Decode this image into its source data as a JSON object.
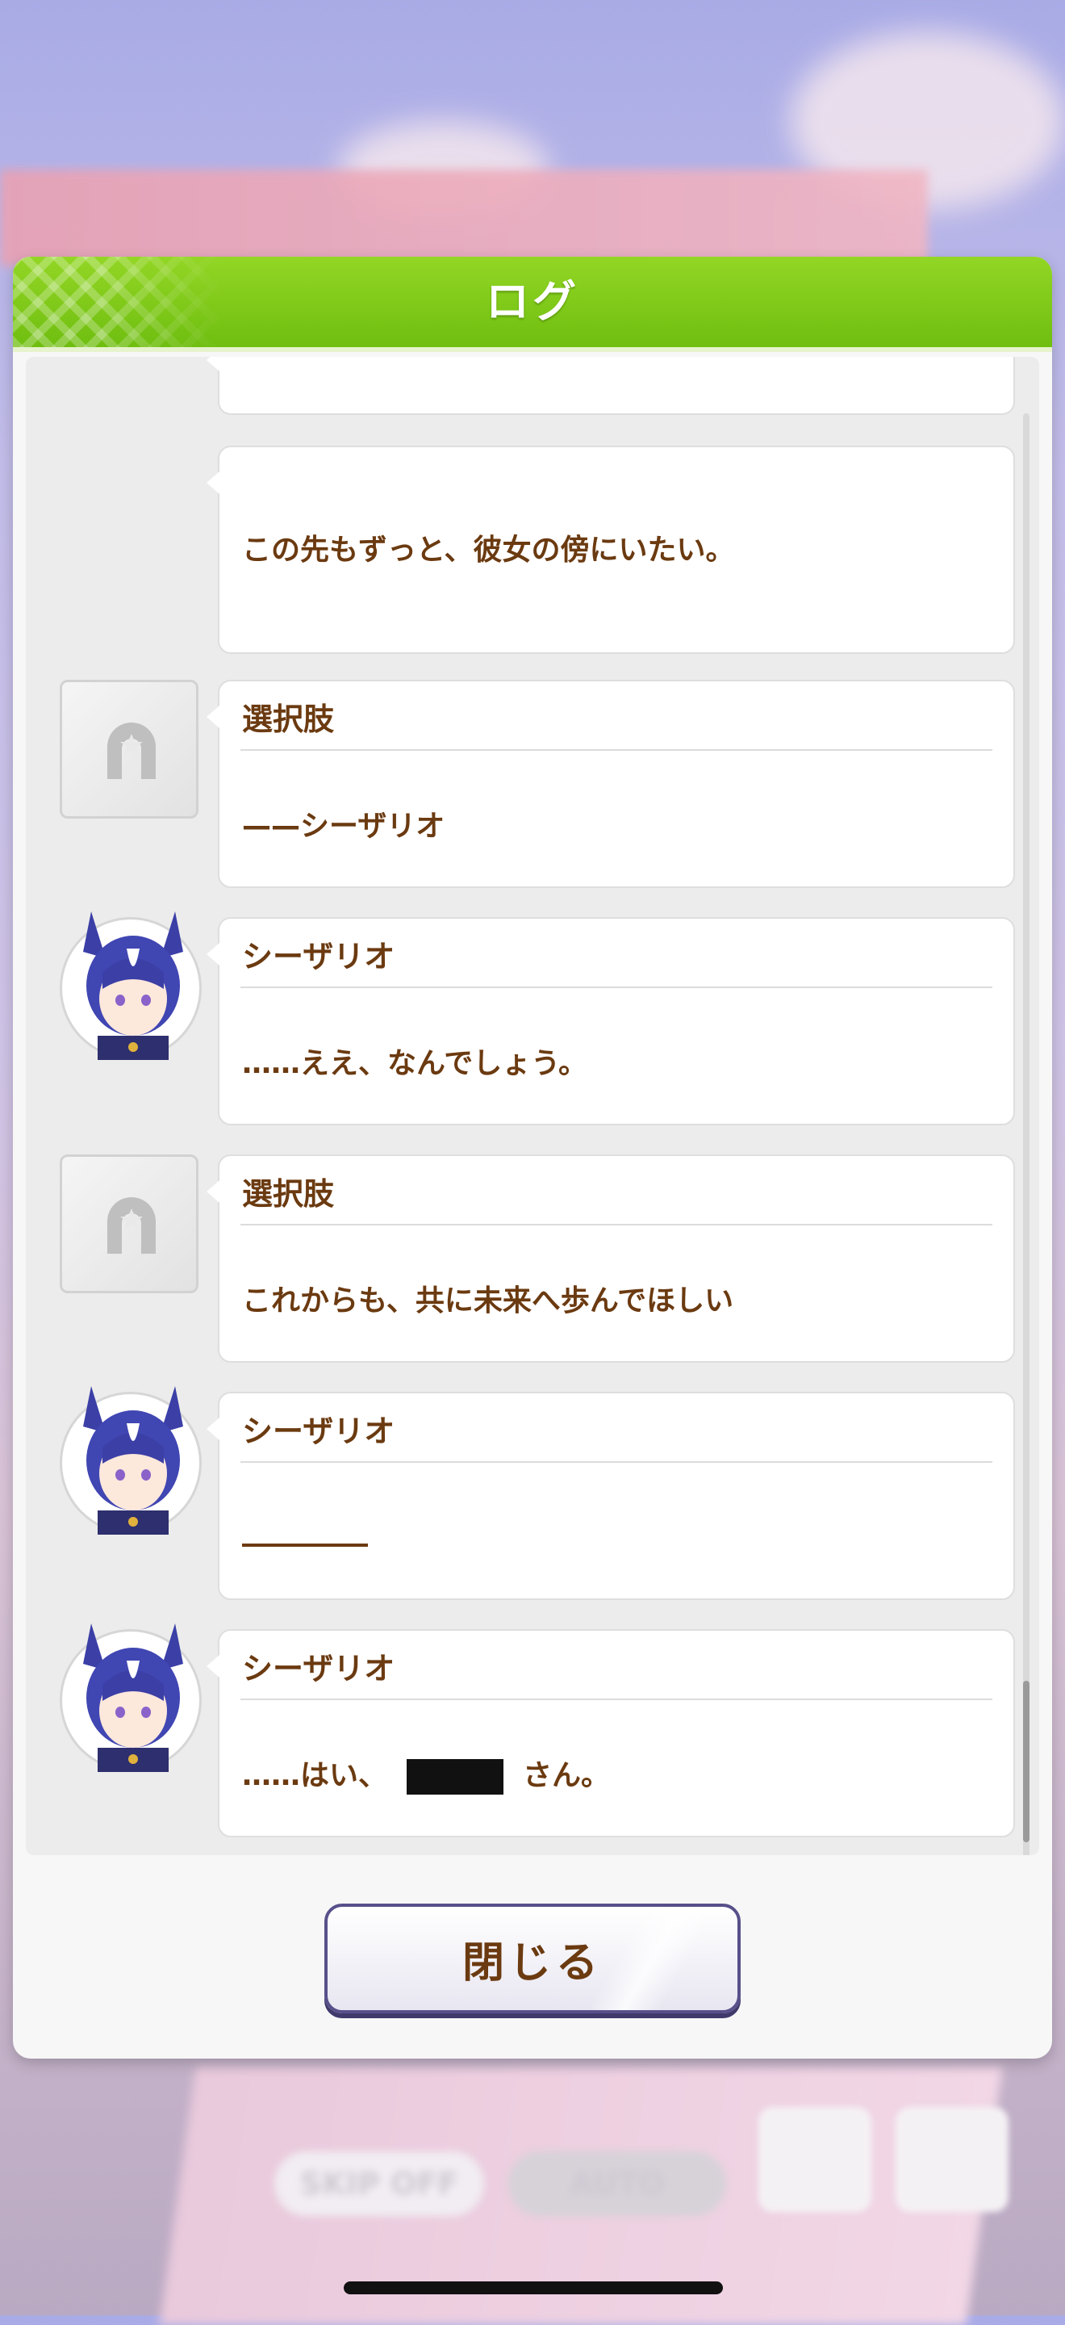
{
  "header": {
    "title": "ログ"
  },
  "background": {
    "skip_label": "SKIP OFF",
    "auto_label": "AUTO"
  },
  "log": {
    "entries": [
      {
        "type": "narration",
        "speaker": "",
        "text": ""
      },
      {
        "type": "narration",
        "speaker": "",
        "text": "この先もずっと、彼女の傍にいたい。"
      },
      {
        "type": "choice",
        "speaker": "選択肢",
        "text": "——シーザリオ"
      },
      {
        "type": "character",
        "speaker": "シーザリオ",
        "text": "……ええ、なんでしょう。"
      },
      {
        "type": "choice",
        "speaker": "選択肢",
        "text": "これからも、共に未来へ歩んでほしい"
      },
      {
        "type": "character",
        "speaker": "シーザリオ",
        "text": ""
      },
      {
        "type": "character",
        "speaker": "シーザリオ",
        "text_before": "……はい、",
        "text_after": "さん。"
      }
    ]
  },
  "footer": {
    "close_label": "閉じる"
  },
  "colors": {
    "header_green": "#7cc71a",
    "text_brown": "#6b3a10",
    "button_border": "#57508a"
  }
}
